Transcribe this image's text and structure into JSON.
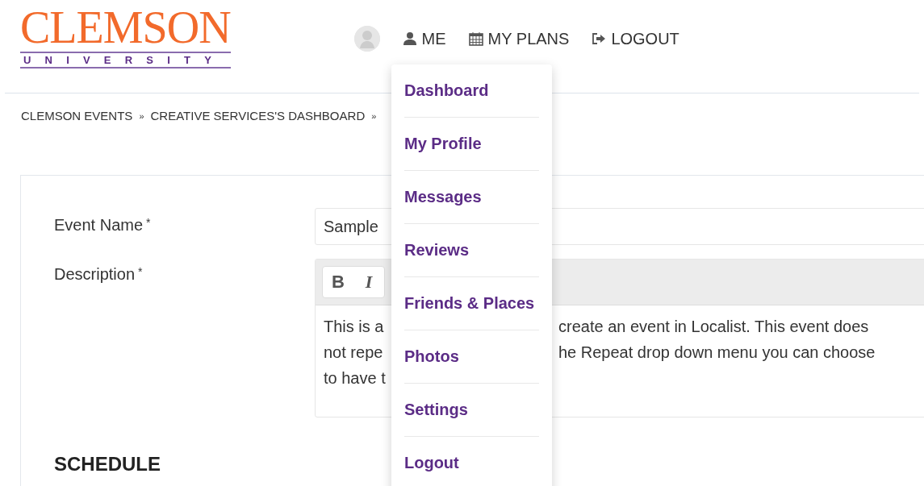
{
  "logo": {
    "name": "CLEMSON",
    "subtitle": "UNIVERSITY"
  },
  "nav": [
    {
      "kind": "avatar"
    },
    {
      "kind": "user",
      "label": "ME"
    },
    {
      "kind": "calendar",
      "label": "MY PLANS"
    },
    {
      "kind": "logout",
      "label": "LOGOUT"
    }
  ],
  "breadcrumb": [
    "CLEMSON EVENTS",
    "CREATIVE SERVICES'S DASHBOARD"
  ],
  "breadcrumb_separator": "»",
  "form": {
    "event_name_label": "Event Name",
    "required_mark": "*",
    "event_name_value": "Sample",
    "description_label": "Description",
    "toolbar": [
      "B",
      "I"
    ],
    "description_left": [
      "This is a",
      "not repe",
      "to have t"
    ],
    "description_right": [
      "create an event in Localist. This event does",
      "he Repeat drop down menu you can choose"
    ],
    "schedule_heading": "SCHEDULE"
  },
  "menu": [
    "Dashboard",
    "My Profile",
    "Messages",
    "Reviews",
    "Friends & Places",
    "Photos",
    "Settings",
    "Logout"
  ]
}
